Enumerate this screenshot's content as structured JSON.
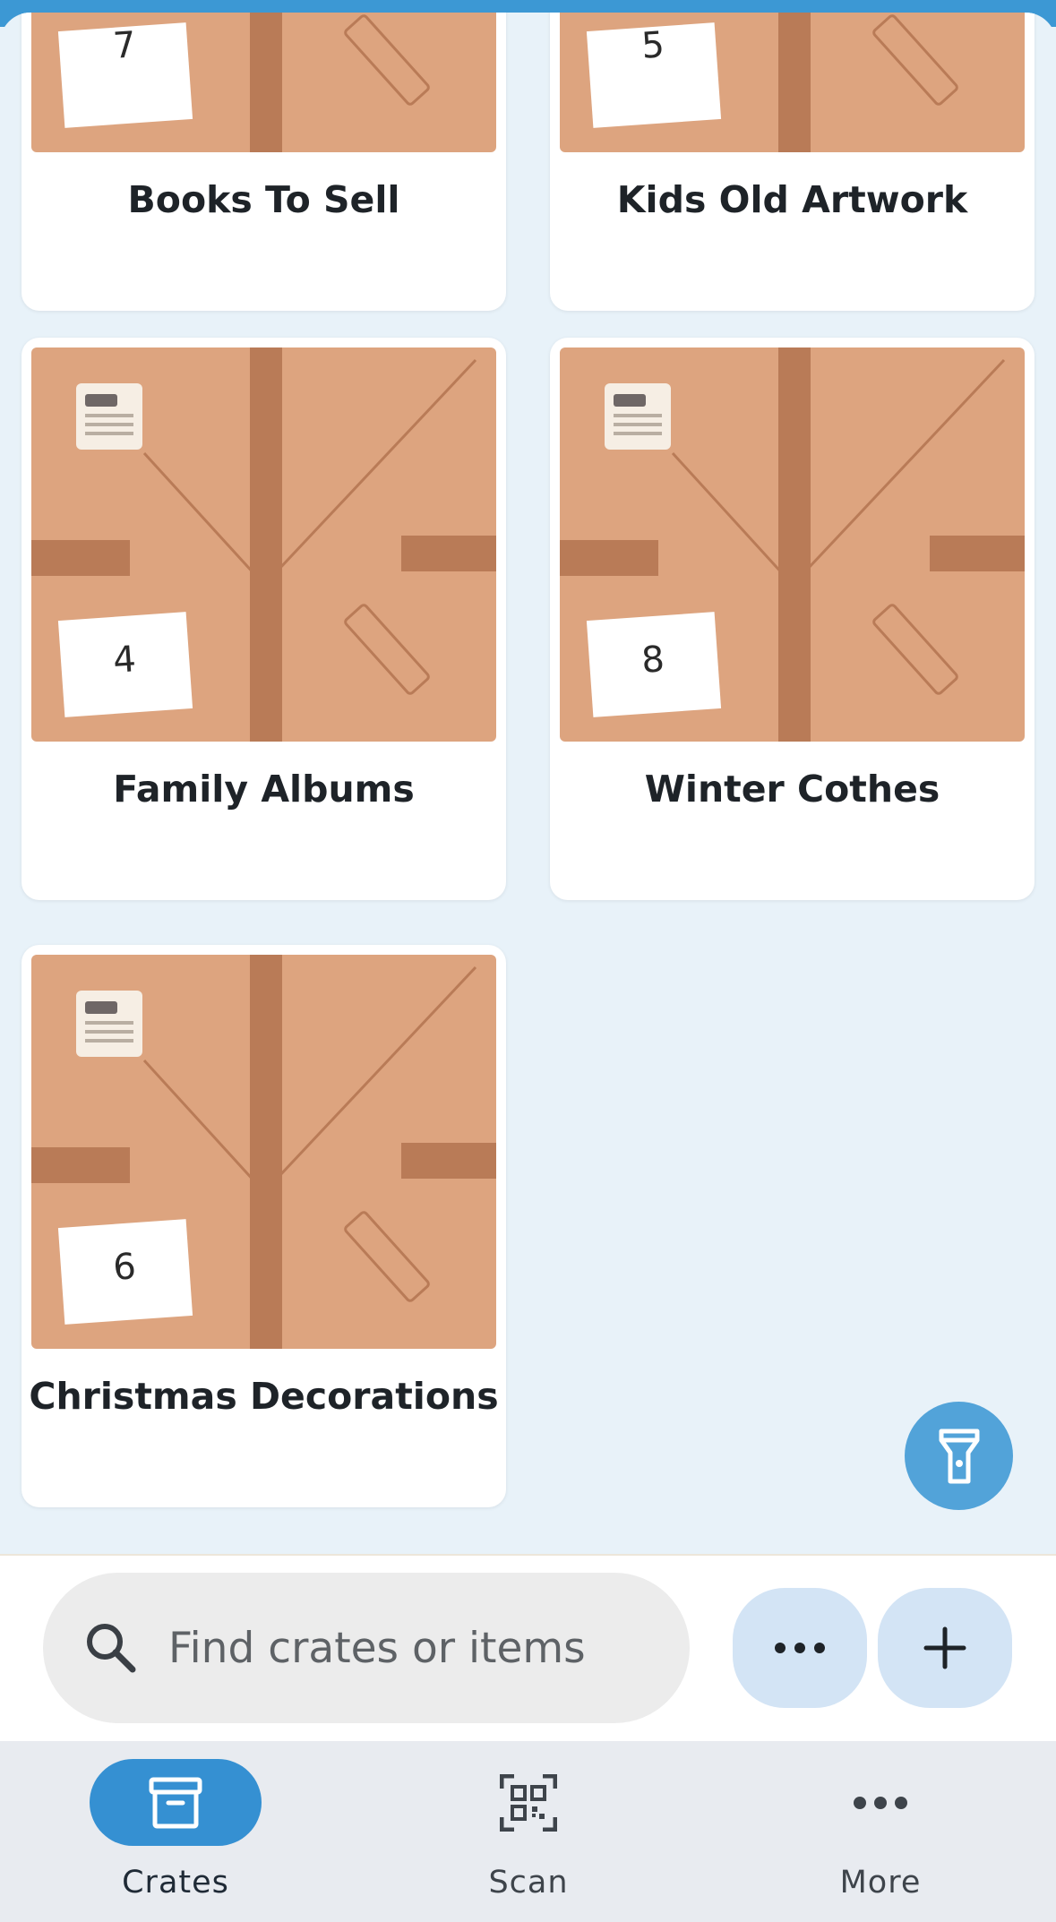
{
  "crates": [
    {
      "name": "Books To Sell",
      "number": "7"
    },
    {
      "name": "Kids Old Artwork",
      "number": "5"
    },
    {
      "name": "Family Albums",
      "number": "4"
    },
    {
      "name": "Winter Cothes",
      "number": "8"
    },
    {
      "name": "Christmas Decorations",
      "number": "6"
    }
  ],
  "fab": {
    "icon": "flashlight-icon"
  },
  "search": {
    "placeholder": "Find crates or items",
    "icon": "search-icon"
  },
  "actions": {
    "more_icon": "ellipsis-icon",
    "add_icon": "plus-icon"
  },
  "nav": {
    "items": [
      {
        "label": "Crates",
        "icon": "archive-box-icon",
        "active": true
      },
      {
        "label": "Scan",
        "icon": "qr-code-icon",
        "active": false
      },
      {
        "label": "More",
        "icon": "ellipsis-icon",
        "active": false
      }
    ]
  },
  "colors": {
    "accent": "#3590d2",
    "fab": "#52a3d9",
    "background": "#e8f2f9",
    "cardboard": "#dda47f",
    "tape": "#b97b57"
  }
}
